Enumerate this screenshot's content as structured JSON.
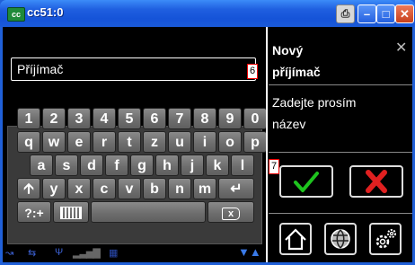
{
  "window": {
    "title": "cc51:0",
    "app_icon_text": "cc"
  },
  "left": {
    "recipient_field": {
      "value": "Příjímač",
      "marker": "6"
    },
    "keyboard": {
      "row1": [
        "1",
        "2",
        "3",
        "4",
        "5",
        "6",
        "7",
        "8",
        "9",
        "0"
      ],
      "row2": [
        "q",
        "w",
        "e",
        "r",
        "t",
        "z",
        "u",
        "i",
        "o",
        "p"
      ],
      "row3": [
        "a",
        "s",
        "d",
        "f",
        "g",
        "h",
        "j",
        "k",
        "l"
      ],
      "row4": [
        "y",
        "x",
        "c",
        "v",
        "b",
        "n",
        "m"
      ],
      "shift_icon": "shift-arrow-up-icon",
      "enter_icon": "enter-arrow-icon",
      "symbols_label": "?:+",
      "keyboard_icon": "keyboard-icon",
      "backspace_icon": "backspace-icon",
      "backspace_label": "x"
    }
  },
  "right": {
    "title_line1": "Nový",
    "title_line2": "příjímač",
    "prompt_line1": "Zadejte prosím",
    "prompt_line2": "název",
    "marker": "7",
    "ok_icon": "checkmark-icon",
    "cancel_icon": "red-x-icon",
    "nav": [
      "home-icon",
      "globe-icon",
      "gear-icon"
    ]
  },
  "colors": {
    "ok": "#1ec31e",
    "cancel": "#e02020",
    "titlebar": "#1f5fe0"
  }
}
